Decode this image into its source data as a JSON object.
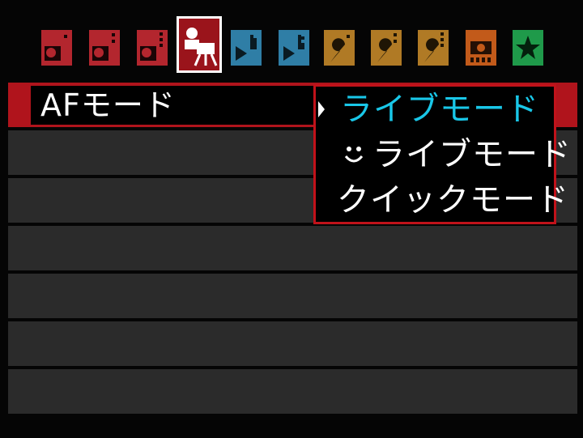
{
  "tabs": [
    {
      "name": "shooting-1",
      "color": "#b3262e",
      "type": "camera",
      "marks": 1
    },
    {
      "name": "shooting-2",
      "color": "#b3262e",
      "type": "camera",
      "marks": 2
    },
    {
      "name": "shooting-3",
      "color": "#b3262e",
      "type": "camera",
      "marks": 3
    },
    {
      "name": "live-view",
      "color": "#ffffff",
      "type": "liveview",
      "selected": true
    },
    {
      "name": "playback-1",
      "color": "#2f7ea6",
      "type": "playback",
      "marks": 1
    },
    {
      "name": "playback-2",
      "color": "#2f7ea6",
      "type": "playback",
      "marks": 2
    },
    {
      "name": "setup-1",
      "color": "#b07a25",
      "type": "wrench",
      "marks": 1
    },
    {
      "name": "setup-2",
      "color": "#b07a25",
      "type": "wrench",
      "marks": 2
    },
    {
      "name": "setup-3",
      "color": "#b07a25",
      "type": "wrench",
      "marks": 3
    },
    {
      "name": "custom-functions",
      "color": "#c25a1a",
      "type": "cfn"
    },
    {
      "name": "my-menu",
      "color": "#1f9a4a",
      "type": "star"
    }
  ],
  "menu": {
    "item_label": "AFモード",
    "row_count": 7
  },
  "dropdown": {
    "options": [
      {
        "label": "ライブモード",
        "selected": true
      },
      {
        "label": "ライブモード",
        "face": true
      },
      {
        "label": "クイックモード"
      }
    ]
  },
  "colors": {
    "highlight": "#b0141c",
    "selected_text": "#19c7e8",
    "row_bg": "#2b2b2b"
  }
}
